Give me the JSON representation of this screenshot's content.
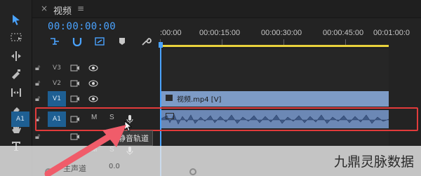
{
  "tab": {
    "close": "×",
    "title": "视频",
    "menu": "≡"
  },
  "timecode": "00:00:00:00",
  "ruler": {
    "labels": [
      ":00:00",
      "00:00:15:00",
      "00:00:30:00",
      "00:00:45:00",
      "00:01:00:0"
    ]
  },
  "tracks": {
    "v3": {
      "name": "V3"
    },
    "v2": {
      "name": "V2"
    },
    "v1": {
      "name": "V1"
    },
    "a1": {
      "source": "A1",
      "name": "A1",
      "mute": "M",
      "solo": "S"
    },
    "a2": {
      "mute": "M",
      "solo": "S"
    },
    "master": {
      "name": "主声道",
      "value": "0.0"
    }
  },
  "clips": {
    "video_label": "视频.mp4 [V]"
  },
  "tooltip": "静音轨道",
  "watermark": "九鼎灵脉数据",
  "colors": {
    "accent": "#4aa3ff",
    "highlight": "#e23b3b",
    "clip_video": "#7d9bc6",
    "clip_audio": "#6c88b5",
    "ruler_bar": "#e9d23c"
  },
  "icons": {
    "tools": [
      "selection-icon",
      "track-select-icon",
      "ripple-edit-icon",
      "razor-icon",
      "slip-icon",
      "pen-icon",
      "hand-icon",
      "type-icon"
    ],
    "header": [
      "snap-icon",
      "magnet-icon",
      "linked-select-icon",
      "marker-icon",
      "wrench-icon"
    ]
  }
}
